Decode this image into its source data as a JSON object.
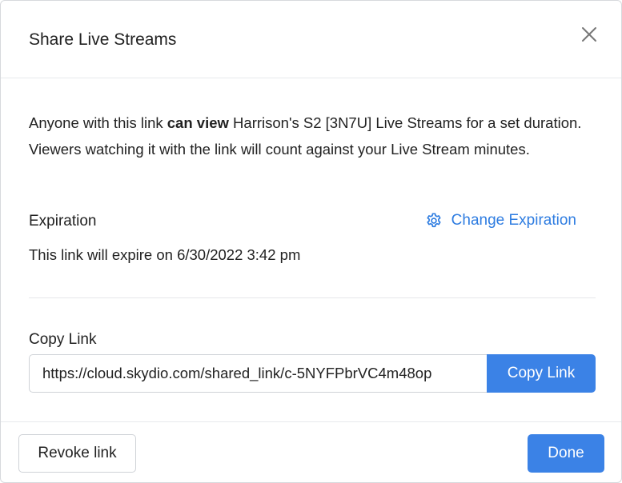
{
  "dialog": {
    "title": "Share Live Streams",
    "close_icon": "close-icon"
  },
  "description": {
    "prefix": "Anyone with this link ",
    "emphasis": "can view",
    "suffix": " Harrison's S2 [3N7U] Live Streams for a set duration. Viewers watching it with the link will count against your Live Stream minutes."
  },
  "expiration": {
    "label": "Expiration",
    "change_label": "Change Expiration",
    "change_icon": "gear-icon",
    "expire_text": "This link will expire on 6/30/2022 3:42 pm"
  },
  "copy_link": {
    "label": "Copy Link",
    "url": "https://cloud.skydio.com/shared_link/c-5NYFPbrVC4m48op",
    "button_label": "Copy Link"
  },
  "footer": {
    "revoke_label": "Revoke link",
    "done_label": "Done"
  },
  "colors": {
    "accent": "#3b82e6",
    "link": "#2f7de1",
    "border": "#cfd2d7"
  }
}
